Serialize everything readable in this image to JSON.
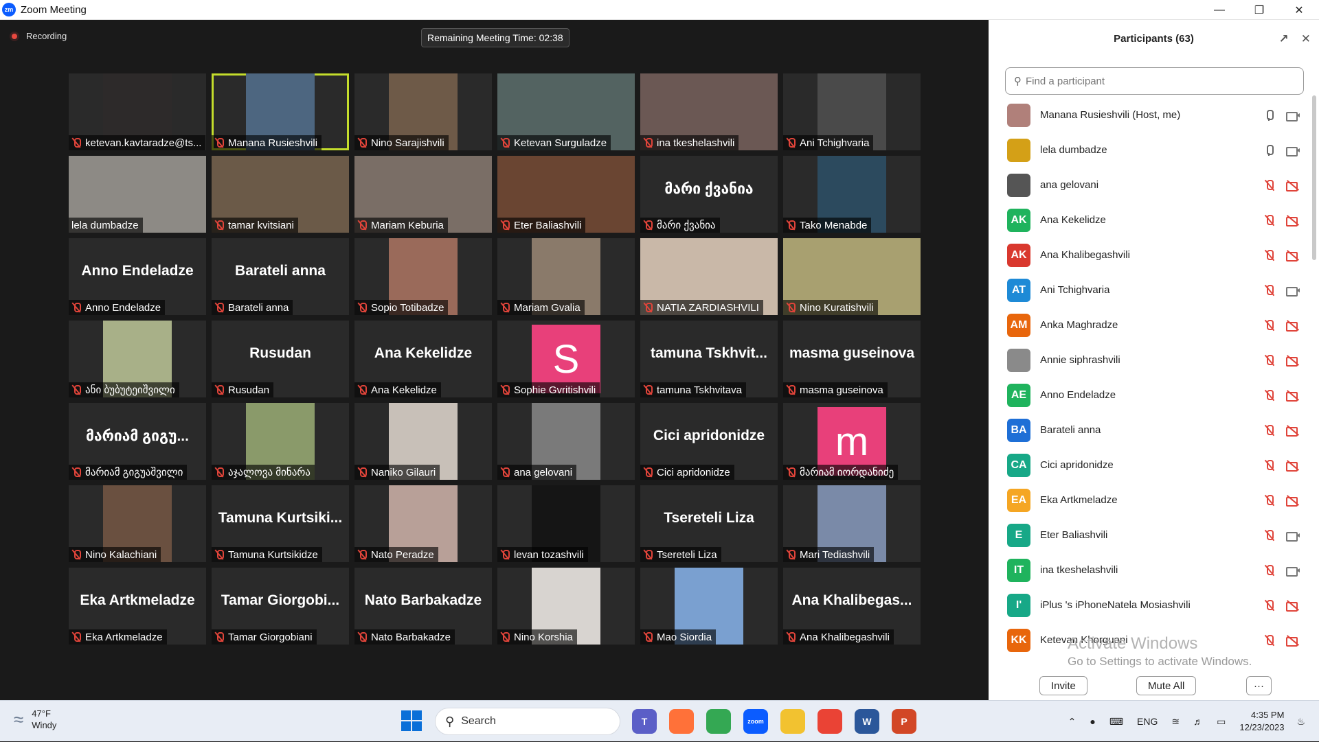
{
  "window": {
    "title": "Zoom Meeting",
    "logo_text": "zm"
  },
  "meeting": {
    "recording_label": "Recording",
    "timer": "Remaining Meeting Time: 02:38",
    "tiles": [
      {
        "name": "ketevan.kavtaradze@ts...",
        "video": true,
        "color": "#2d2a2a"
      },
      {
        "name": "Manana Rusieshvili",
        "video": true,
        "active": true,
        "color": "#4d6680"
      },
      {
        "name": "Nino Sarajishvili",
        "video": true,
        "color": "#6e5a48"
      },
      {
        "name": "Ketevan Surguladze",
        "video": true,
        "wide": true,
        "color": "#536361"
      },
      {
        "name": "ina tkeshelashvili",
        "video": true,
        "wide": true,
        "color": "#6b5854"
      },
      {
        "name": "Ani Tchighvaria",
        "video": true,
        "color": "#4a4a4a"
      },
      {
        "name": "lela dumbadze",
        "video": true,
        "wide": true,
        "color": "#8d8a85",
        "nomute": true
      },
      {
        "name": "tamar kvitsiani",
        "video": true,
        "wide": true,
        "color": "#6b5a48"
      },
      {
        "name": "Mariam Keburia",
        "video": true,
        "wide": true,
        "color": "#7a6e66"
      },
      {
        "name": "Eter Baliashvili",
        "video": true,
        "wide": true,
        "color": "#6a4532"
      },
      {
        "name": "მარი ქვანია",
        "big": "მარი ქვანია"
      },
      {
        "name": "Tako Menabde",
        "video": true,
        "color": "#2c4a5e"
      },
      {
        "name": "Anno Endeladze",
        "big": "Anno Endeladze"
      },
      {
        "name": "Barateli anna",
        "big": "Barateli anna"
      },
      {
        "name": "Sopio Totibadze",
        "video": true,
        "color": "#9a6a5a"
      },
      {
        "name": "Mariam Gvalia",
        "video": true,
        "color": "#8a7a6a"
      },
      {
        "name": "NATIA ZARDIASHVILI",
        "video": true,
        "wide": true,
        "color": "#c9b8a8"
      },
      {
        "name": "Nino Kuratishvili",
        "video": true,
        "wide": true,
        "color": "#a8a070"
      },
      {
        "name": "ანი ბუბუტეიშვილი",
        "video": true,
        "color": "#a8b088"
      },
      {
        "name": "Rusudan",
        "big": "Rusudan"
      },
      {
        "name": "Ana Kekelidze",
        "big": "Ana Kekelidze"
      },
      {
        "name": "Sophie Gvritishvili",
        "avatar": "S",
        "avatar_color": "#e8407a"
      },
      {
        "name": "tamuna Tskhvitava",
        "big": "tamuna  Tskhvit..."
      },
      {
        "name": "masma guseinova",
        "big": "masma guseinova"
      },
      {
        "name": "მარიამ გიგუაშვილი",
        "big": "მარიამ გიგუ..."
      },
      {
        "name": "აჯალოვა მინარა",
        "video": true,
        "color": "#8a9a6a"
      },
      {
        "name": "Naniko Gilauri",
        "video": true,
        "color": "#c8c0b8"
      },
      {
        "name": "ana gelovani",
        "video": true,
        "color": "#7a7a7a"
      },
      {
        "name": "Cici apridonidze",
        "big": "Cici apridonidze"
      },
      {
        "name": "მარიამ იორდანიძე",
        "avatar": "m",
        "avatar_color": "#e8407a"
      },
      {
        "name": "Nino Kalachiani",
        "video": true,
        "color": "#6a5040"
      },
      {
        "name": "Tamuna Kurtsikidze",
        "big": "Tamuna  Kurtsiki..."
      },
      {
        "name": "Nato Peradze",
        "video": true,
        "color": "#b8a098"
      },
      {
        "name": "levan tozashvili",
        "video": true,
        "color": "#151515"
      },
      {
        "name": "Tsereteli Liza",
        "big": "Tsereteli Liza"
      },
      {
        "name": "Mari Tediashvili",
        "video": true,
        "color": "#7a8aa8"
      },
      {
        "name": "Eka Artkmeladze",
        "big": "Eka Artkmeladze"
      },
      {
        "name": "Tamar Giorgobiani",
        "big": "Tamar  Giorgobi..."
      },
      {
        "name": "Nato Barbakadze",
        "big": "Nato Barbakadze"
      },
      {
        "name": "Nino Korshia",
        "video": true,
        "color": "#d8d4d0"
      },
      {
        "name": "Mao Siordia",
        "video": true,
        "color": "#7aa0d0"
      },
      {
        "name": "Ana Khalibegashvili",
        "big": "Ana  Khalibegas..."
      }
    ]
  },
  "participants": {
    "title": "Participants (63)",
    "search_placeholder": "Find a participant",
    "list": [
      {
        "name": "Manana Rusieshvili (Host, me)",
        "initials": "",
        "color": "#b0807a",
        "mic": "on",
        "cam": "on"
      },
      {
        "name": "lela dumbadze",
        "initials": "",
        "color": "#d4a017",
        "mic": "on",
        "cam": "on"
      },
      {
        "name": "ana gelovani",
        "initials": "",
        "color": "#555555",
        "mic": "off",
        "cam": "off"
      },
      {
        "name": "Ana Kekelidze",
        "initials": "AK",
        "color": "#1fb35d",
        "mic": "off",
        "cam": "off"
      },
      {
        "name": "Ana Khalibegashvili",
        "initials": "AK",
        "color": "#d9382e",
        "mic": "off",
        "cam": "off"
      },
      {
        "name": "Ani Tchighvaria",
        "initials": "AT",
        "color": "#1e8ad6",
        "mic": "off",
        "cam": "on"
      },
      {
        "name": "Anka Maghradze",
        "initials": "AM",
        "color": "#e8660c",
        "mic": "off",
        "cam": "off"
      },
      {
        "name": "Annie siphrashvili",
        "initials": "",
        "color": "#8a8a8a",
        "mic": "off",
        "cam": "off"
      },
      {
        "name": "Anno Endeladze",
        "initials": "AE",
        "color": "#1fb35d",
        "mic": "off",
        "cam": "off"
      },
      {
        "name": "Barateli anna",
        "initials": "BA",
        "color": "#1e6fd6",
        "mic": "off",
        "cam": "off"
      },
      {
        "name": "Cici apridonidze",
        "initials": "CA",
        "color": "#17a887",
        "mic": "off",
        "cam": "off"
      },
      {
        "name": "Eka Artkmeladze",
        "initials": "EA",
        "color": "#f5a623",
        "mic": "off",
        "cam": "off"
      },
      {
        "name": "Eter Baliashvili",
        "initials": "E",
        "color": "#17a887",
        "mic": "off",
        "cam": "on"
      },
      {
        "name": "ina tkeshelashvili",
        "initials": "IT",
        "color": "#1fb35d",
        "mic": "off",
        "cam": "on"
      },
      {
        "name": "iPlus 's iPhoneNatela Mosiashvili",
        "initials": "I'",
        "color": "#17a887",
        "mic": "off",
        "cam": "off"
      },
      {
        "name": "Ketevan Khorguani",
        "initials": "KK",
        "color": "#e8660c",
        "mic": "off",
        "cam": "off"
      }
    ],
    "invite_label": "Invite",
    "mute_all_label": "Mute All",
    "more_label": "···"
  },
  "watermark": {
    "line1": "Activate Windows",
    "line2": "Go to Settings to activate Windows."
  },
  "taskbar": {
    "temp": "47°F",
    "condition": "Windy",
    "search_label": "Search",
    "language": "ENG",
    "time": "4:35 PM",
    "date": "12/23/2023",
    "apps": [
      {
        "name": "teams",
        "label": "T",
        "color": "#5b5fc7"
      },
      {
        "name": "firefox",
        "label": "",
        "color": "#ff7139"
      },
      {
        "name": "chrome",
        "label": "",
        "color": "#34a853"
      },
      {
        "name": "zoom",
        "label": "zoom",
        "color": "#0b5cff"
      },
      {
        "name": "file-explorer",
        "label": "",
        "color": "#f2c230"
      },
      {
        "name": "chrome-2",
        "label": "",
        "color": "#ea4335"
      },
      {
        "name": "word",
        "label": "W",
        "color": "#2b579a"
      },
      {
        "name": "powerpoint",
        "label": "P",
        "color": "#d24726"
      }
    ]
  }
}
